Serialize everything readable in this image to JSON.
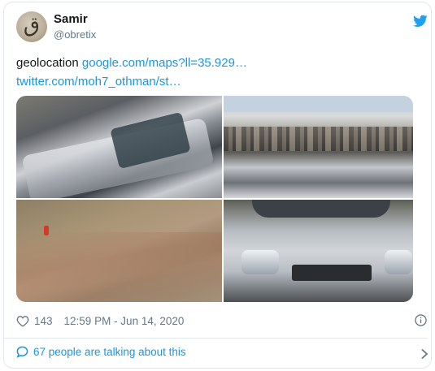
{
  "author": {
    "name": "Samir",
    "handle": "@obretix",
    "avatar_glyph": "ق"
  },
  "tweet": {
    "text_prefix": "geolocation ",
    "link1": "google.com/maps?ll=35.929…",
    "link2": "twitter.com/moh7_othman/st…"
  },
  "media": {
    "count": 4
  },
  "stats": {
    "likes": "143",
    "timestamp": "12:59 PM - Jun 14, 2020"
  },
  "footer": {
    "talking_label": "67 people are talking about this"
  },
  "colors": {
    "link": "#1b95e0",
    "secondary_text": "#657786",
    "border": "#e1e8ed",
    "twitter_blue": "#1da1f2"
  },
  "icons": [
    "twitter-bird-icon",
    "heart-icon",
    "info-icon",
    "comment-bubble-icon",
    "chevron-right-icon"
  ]
}
